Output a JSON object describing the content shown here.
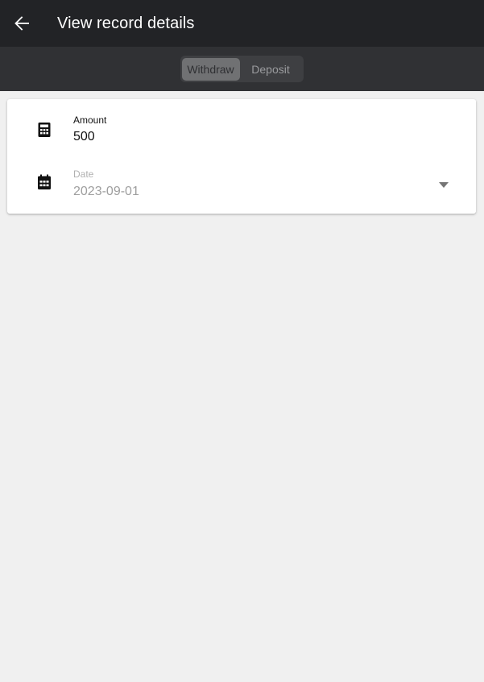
{
  "header": {
    "title": "View record details",
    "back_icon": "arrow-back-icon"
  },
  "toggle": {
    "options": [
      "Withdraw",
      "Deposit"
    ],
    "selected": "Withdraw"
  },
  "form": {
    "amount": {
      "label": "Amount",
      "value": "500",
      "icon": "calculator-icon"
    },
    "date": {
      "label": "Date",
      "value": "2023-09-01",
      "icon": "calendar-icon",
      "dropdown_icon": "caret-down-icon"
    }
  },
  "colors": {
    "app_bar": "#222326",
    "toggle_bar": "#303134",
    "selected_segment": "#707173",
    "page_background": "#f0f0f0",
    "card": "#ffffff"
  }
}
